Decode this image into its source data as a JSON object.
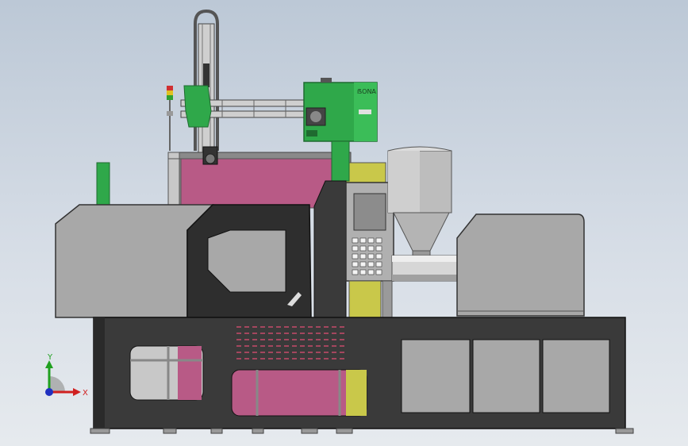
{
  "viewport": {
    "background_top": "#bcc8d6",
    "background_bottom": "#e6eaee"
  },
  "model": {
    "colors": {
      "frame_dark": "#3a3a3a",
      "machine_gray": "#a8a8a8",
      "robot_green": "#2fa84a",
      "guard_pink": "#b85a86",
      "guard_yellow": "#c9c84a",
      "hopper_gray": "#b4b4b4"
    },
    "robot_brand": "ẞONA"
  },
  "triad": {
    "x_label": "X",
    "y_label": "Y",
    "x_color": "#d02020",
    "y_color": "#20a020",
    "z_color": "#2030c0"
  }
}
